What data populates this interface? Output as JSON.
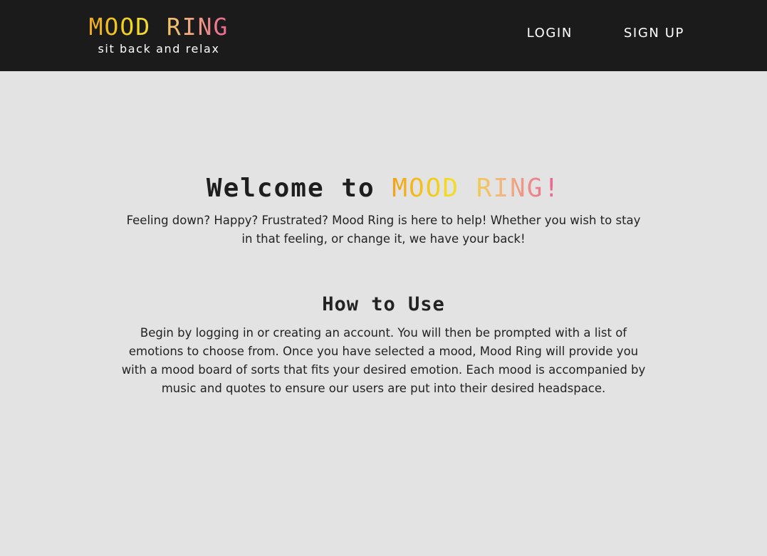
{
  "brand": {
    "title": "MOOD RING",
    "tagline": "sit back and relax"
  },
  "nav": {
    "login": "LOGIN",
    "signup": "SIGN UP"
  },
  "welcome": {
    "prefix": "Welcome to ",
    "highlight": "MOOD RING!",
    "text": "Feeling down? Happy? Frustrated? Mood Ring is here to help! Whether you wish to stay in that feeling, or change it, we have your back!"
  },
  "how_to": {
    "heading": "How to Use",
    "text": "Begin by logging in or creating an account. You will then be prompted with a list of emotions to choose from. Once you have selected a mood, Mood Ring will provide you with a mood board of sorts that fits your desired emotion. Each mood is accompanied by music and quotes to ensure our users are put into their desired headspace."
  },
  "colors": {
    "navbar_bg": "#1b1b1b",
    "page_bg": "#e3e3e3",
    "gradient": [
      "#f0a21a",
      "#f3de22",
      "#f1b77f",
      "#e95c93"
    ]
  }
}
